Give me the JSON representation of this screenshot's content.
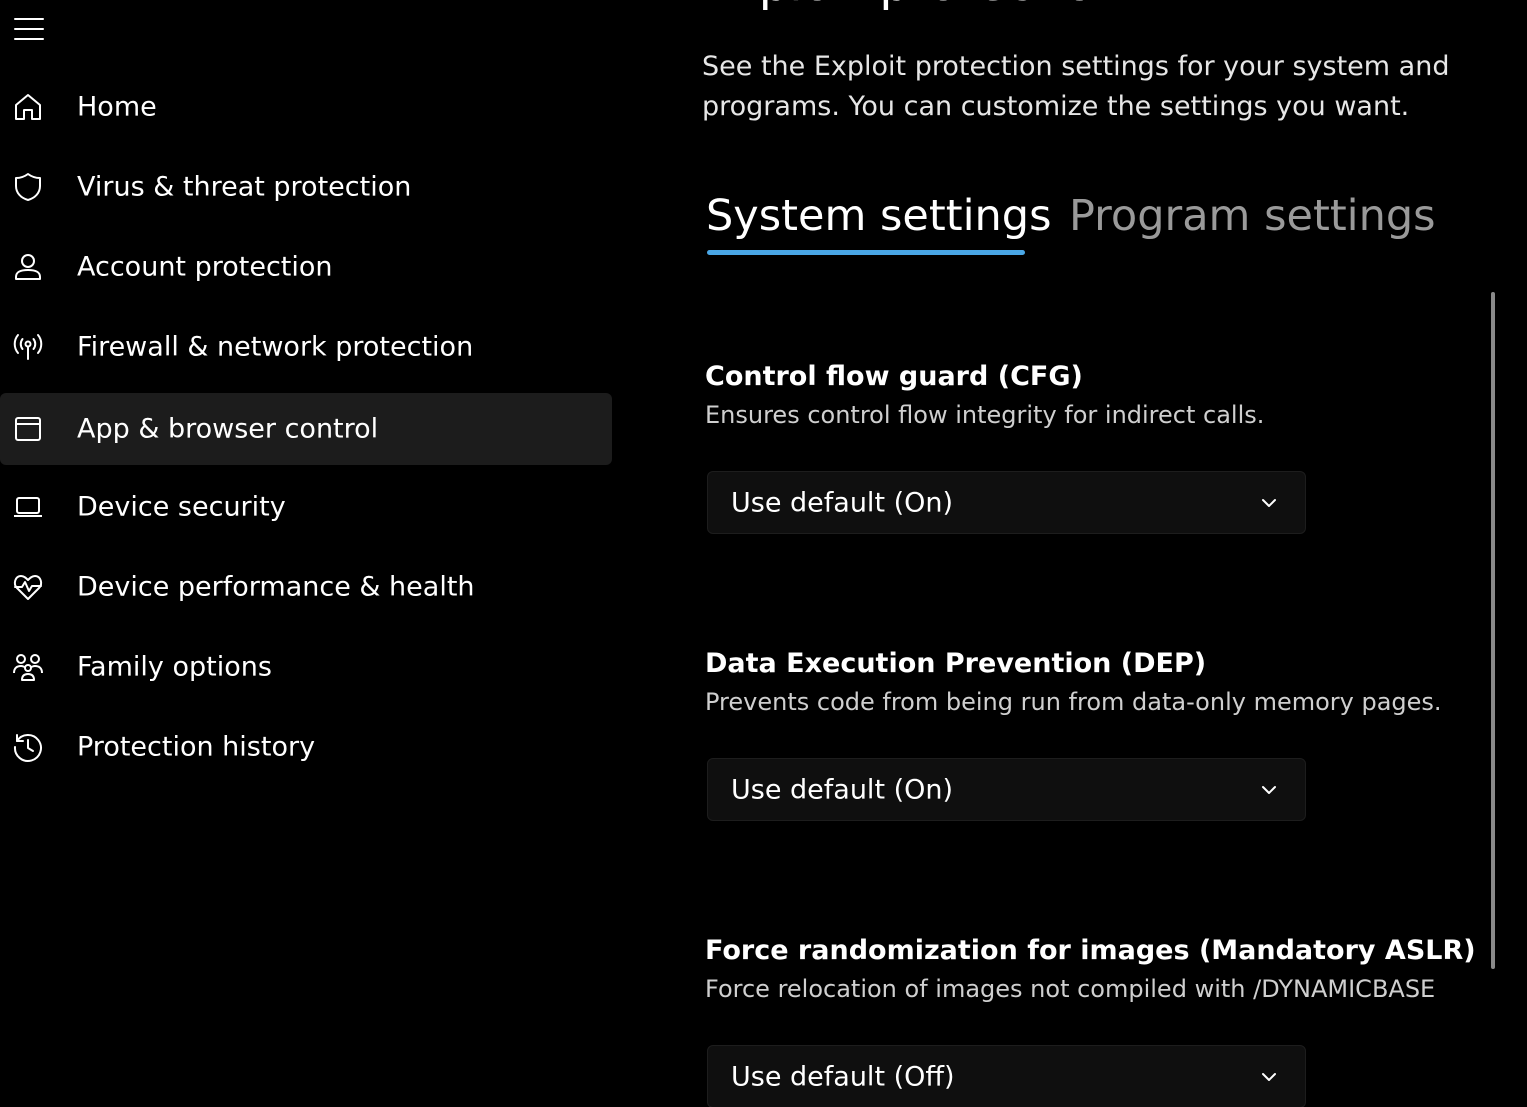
{
  "sidebar": {
    "items": [
      {
        "label": "Home",
        "icon": "home-icon"
      },
      {
        "label": "Virus & threat protection",
        "icon": "shield-icon"
      },
      {
        "label": "Account protection",
        "icon": "person-icon"
      },
      {
        "label": "Firewall & network protection",
        "icon": "antenna-icon"
      },
      {
        "label": "App & browser control",
        "icon": "app-window-icon",
        "selected": true
      },
      {
        "label": "Device security",
        "icon": "laptop-icon"
      },
      {
        "label": "Device performance & health",
        "icon": "heart-pulse-icon"
      },
      {
        "label": "Family options",
        "icon": "family-icon"
      },
      {
        "label": "Protection history",
        "icon": "history-icon"
      }
    ]
  },
  "main": {
    "title": "Exploit protection",
    "description": "See the Exploit protection settings for your system and programs.  You can customize the settings you want.",
    "tabs": [
      {
        "label": "System settings",
        "selected": true
      },
      {
        "label": "Program settings",
        "selected": false
      }
    ],
    "settings": [
      {
        "title": "Control flow guard (CFG)",
        "description": "Ensures control flow integrity for indirect calls.",
        "value": "Use default (On)"
      },
      {
        "title": "Data Execution Prevention (DEP)",
        "description": "Prevents code from being run from data-only memory pages.",
        "value": "Use default (On)"
      },
      {
        "title": "Force randomization for images (Mandatory ASLR)",
        "description": "Force relocation of images not compiled with /DYNAMICBASE",
        "value": "Use default (Off)"
      }
    ]
  },
  "colors": {
    "background": "#000000",
    "selected_nav": "#1c1c1c",
    "accent": "#4aa7e6",
    "dropdown_bg": "#0f0f0f"
  }
}
